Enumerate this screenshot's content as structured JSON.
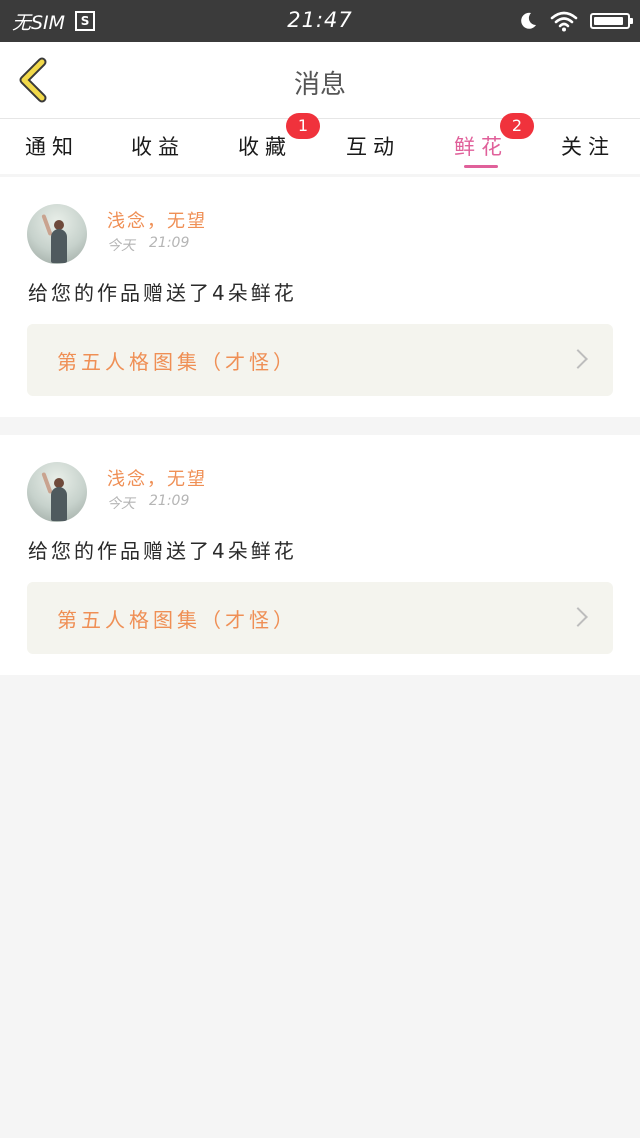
{
  "status_bar": {
    "carrier": "无SIM",
    "sim_icon_label": "S",
    "time": "21:47",
    "icons": [
      "moon-icon",
      "wifi-icon",
      "battery-icon"
    ],
    "battery_level": 0.9
  },
  "nav": {
    "title": "消息",
    "back_icon": "chevron-left-icon"
  },
  "tabs": [
    {
      "label": "通知",
      "badge": ""
    },
    {
      "label": "收益",
      "badge": ""
    },
    {
      "label": "收藏",
      "badge": "1"
    },
    {
      "label": "互动",
      "badge": ""
    },
    {
      "label": "鲜花",
      "badge": "2",
      "active": true
    },
    {
      "label": "关注",
      "badge": ""
    }
  ],
  "messages": [
    {
      "user": "浅念，无望",
      "date": "今天",
      "time": "21:09",
      "text": "给您的作品赠送了4朵鲜花",
      "work": "第五人格图集（才怪）"
    },
    {
      "user": "浅念，无望",
      "date": "今天",
      "time": "21:09",
      "text": "给您的作品赠送了4朵鲜花",
      "work": "第五人格图集（才怪）"
    }
  ],
  "colors": {
    "accent_pink": "#e0609a",
    "accent_orange": "#ef8f55",
    "badge_red": "#f0323c",
    "back_icon_yellow": "#f2d94a"
  }
}
